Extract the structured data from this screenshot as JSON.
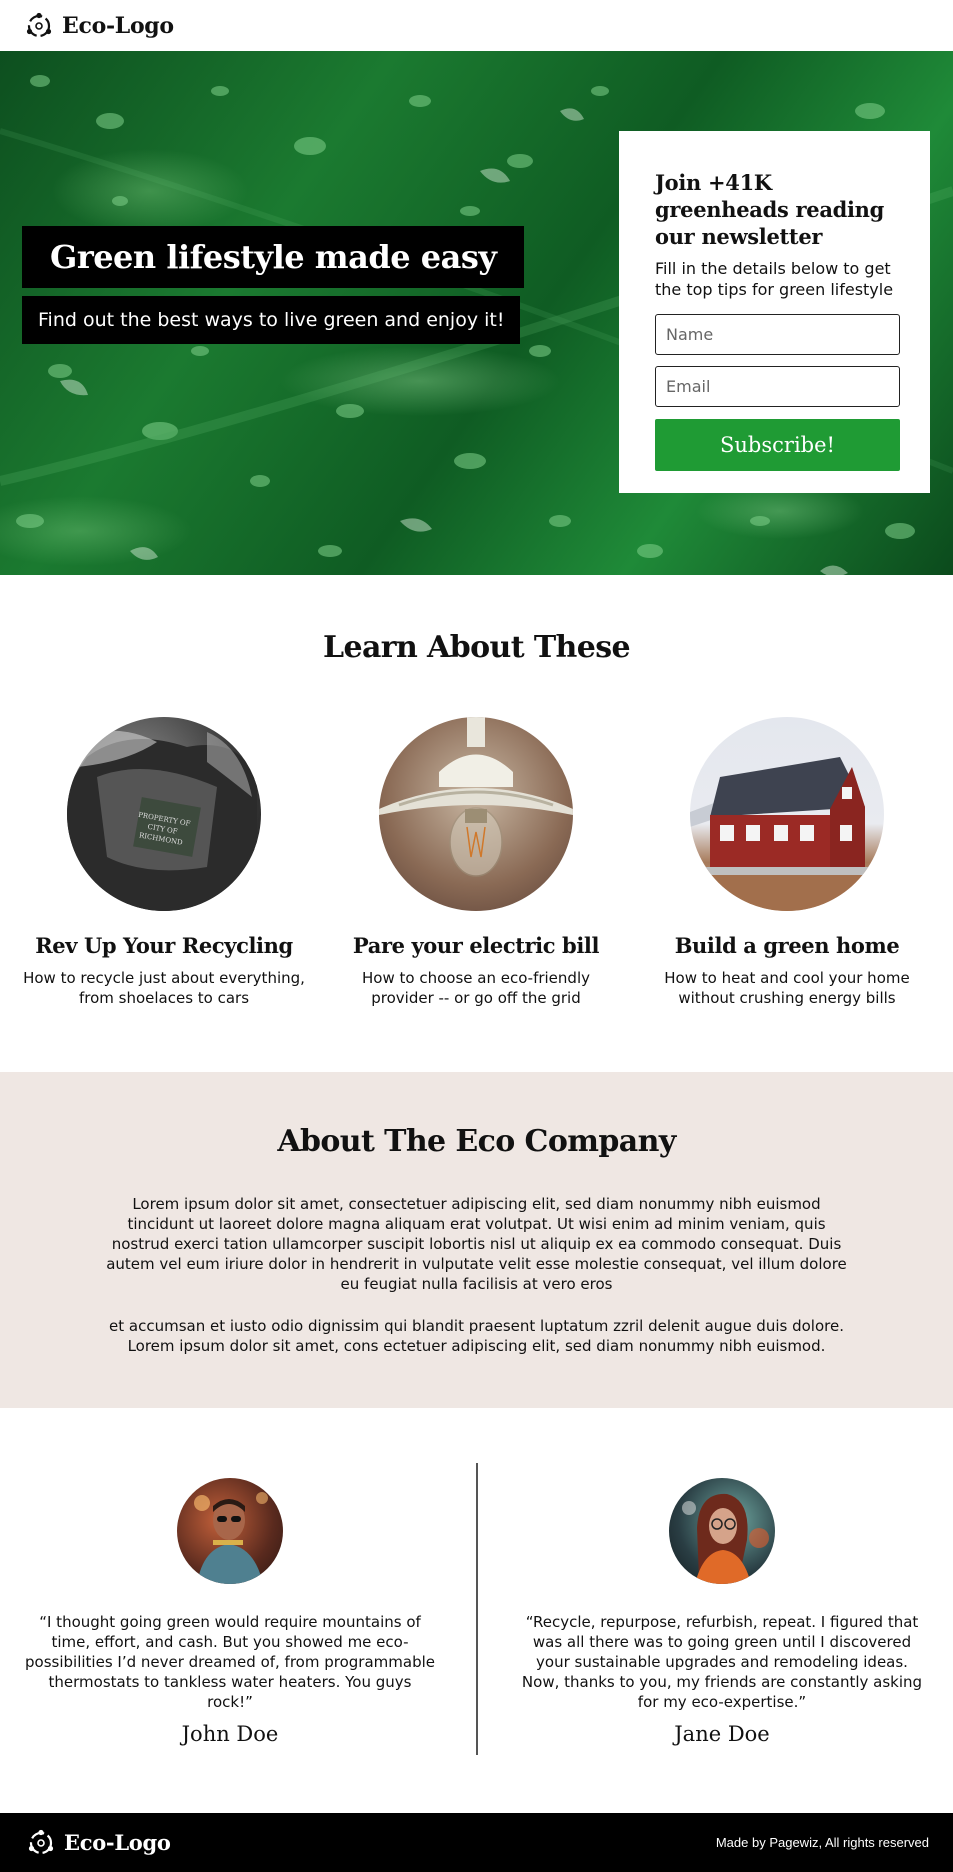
{
  "header": {
    "logo_text": "Eco-Logo"
  },
  "hero": {
    "title": "Green lifestyle made easy",
    "subtitle": "Find out the best ways to live green and enjoy it!"
  },
  "signup": {
    "title": "Join +41K greenheads reading our newsletter",
    "description": "Fill in the details below to get the top tips for green lifestyle",
    "name_placeholder": "Name",
    "email_placeholder": "Email",
    "button_label": "Subscribe!",
    "button_color": "#1f9b34"
  },
  "learn": {
    "title": "Learn About These",
    "cards": [
      {
        "title": "Rev Up Your Recycling",
        "description": "How to recycle just about everything, from shoelaces to cars",
        "image": "recycling-bin-photo"
      },
      {
        "title": "Pare your electric bill",
        "description": "How to choose an eco-friendly provider -- or go off the grid",
        "image": "light-bulb-photo"
      },
      {
        "title": "Build a green home",
        "description": "How to heat and cool your home without crushing energy bills",
        "image": "red-house-photo"
      }
    ]
  },
  "about": {
    "title": "About The Eco Company",
    "paragraph_1": "Lorem ipsum dolor sit amet, consectetuer adipiscing elit, sed diam nonummy nibh euismod tincidunt ut laoreet dolore magna aliquam erat volutpat. Ut wisi enim ad minim veniam, quis nostrud exerci tation ullamcorper suscipit lobortis nisl ut aliquip ex ea commodo consequat. Duis autem vel eum iriure dolor in hendrerit in vulputate velit esse molestie consequat, vel illum dolore eu feugiat nulla facilisis at vero eros",
    "paragraph_2": "et accumsan et iusto odio dignissim qui blandit praesent luptatum zzril delenit augue duis dolore. Lorem ipsum dolor sit amet, cons ectetuer adipiscing elit, sed diam nonummy nibh euismod.",
    "background_color": "#efe7e3"
  },
  "testimonials": [
    {
      "quote": "“I thought going green would require mountains of time, effort, and cash. But you showed me eco-possibilities I’d never dreamed of, from programmable thermostats to tankless water heaters. You guys rock!”",
      "name": "John Doe"
    },
    {
      "quote": "“Recycle, repurpose, refurbish, repeat. I figured that was all there was to going green until I discovered your sustainable upgrades and remodeling ideas. Now, thanks to you, my friends are constantly asking for my eco-expertise.”",
      "name": "Jane Doe"
    }
  ],
  "footer": {
    "logo_text": "Eco-Logo",
    "note": "Made by Pagewiz, All rights reserved"
  }
}
